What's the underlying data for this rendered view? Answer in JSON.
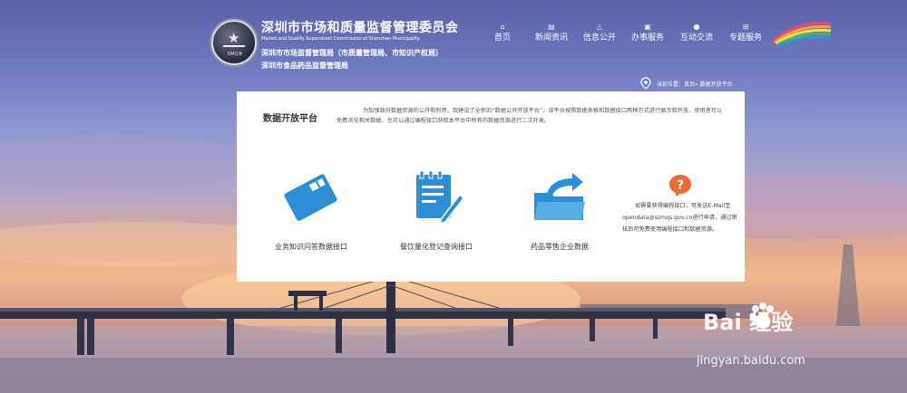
{
  "header": {
    "logo_emblem_text": "SMQB",
    "org_title": "深圳市市场和质量监督管理委员会",
    "org_en": "Market and Quality Supervision Commission of Shenzhen Municipality",
    "org_sub1": "深圳市市场监督管理局（市质量管理局、市知识产权局）",
    "org_sub2": "深圳市食品药品监督管理局"
  },
  "nav": {
    "items": [
      {
        "label": "首页",
        "icon": "home-icon"
      },
      {
        "label": "新闻资讯",
        "icon": "news-icon"
      },
      {
        "label": "信息公开",
        "icon": "info-icon"
      },
      {
        "label": "办事服务",
        "icon": "briefcase-icon"
      },
      {
        "label": "互动交流",
        "icon": "chat-icon"
      },
      {
        "label": "专题服务",
        "icon": "grid-icon"
      }
    ]
  },
  "location": {
    "prefix": "当前位置：",
    "path": "首页» 数据开放平台"
  },
  "panel": {
    "title": "数据开放平台",
    "intro": "为加强政府数据资源的公开和利用，现建设了全新的“数据公开开放平台”。该平台按照数据表格和数据接口两种方式进行展示和开放，使用者可以免费浏览相关数据，也可以通过编程接口获取本平台中所有的数据资源进行二次开发。",
    "features": [
      {
        "label": "业务知识问答数据接口",
        "icon": "card-icon"
      },
      {
        "label": "餐饮量化登记查询接口",
        "icon": "document-edit-icon"
      },
      {
        "label": "药品零售企业数据",
        "icon": "folder-share-icon"
      }
    ],
    "contact_text": "如需要获得编程接口，可发送E-Mail至opendata@szmqs.gov.cn进行申请，通过审核后可免费使用编程接口和数据资源。"
  },
  "watermark": {
    "brand": "Bai  经验",
    "url": "jingyan.baidu.com"
  },
  "colors": {
    "accent_blue": "#2c8fd6",
    "contact_orange": "#ef6a2e",
    "panel_bg": "#ffffff"
  }
}
